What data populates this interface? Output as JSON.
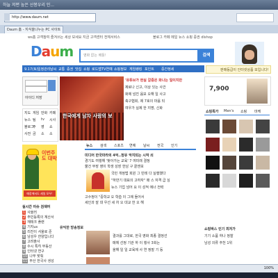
{
  "window": {
    "title": "하늘 저편 높은 산봉우리 인...",
    "address": "http://www.daum.net",
    "tab_label": "Daum 홈 - 지식을나누는 PC 사이트"
  },
  "status": {
    "zoom": "100%"
  },
  "daum": {
    "topnav": "ws홈  고객참여  즐겨쓰는 세상  보세요 지금  고객센터  전체서비스",
    "toplinks": "블로그  카페  메일  뉴스  쇼핑  증권  dlshop",
    "logo": [
      "D",
      "a",
      "u",
      "m"
    ],
    "search_placeholder": "영화 없는 배틀!",
    "search_button": "검색",
    "categories": [
      "9.17(토)",
      "일정관리",
      "날씨",
      "교통",
      "증권",
      "맛집",
      "쇼핑",
      "로드맵",
      "TV연예",
      "쇼핑정보",
      "게임랭킹",
      "포인트",
      "중간정세"
    ],
    "login_hint": "판매등급이 인터넷상품 보입니다!",
    "login_save": "아이디 저장",
    "quicklinks": [
      [
        "지도",
        "게임",
        "만화",
        "카페"
      ],
      [
        "뉴스",
        "팀",
        "tv",
        "시사"
      ],
      [
        "블로그",
        "주",
        "영",
        "쇼"
      ],
      [
        "사전",
        "금",
        "소",
        "소"
      ]
    ],
    "ad_slogan": "이번주도 대박",
    "ad_cta": "매장에서도 세일 모두!",
    "hero_caption": "한국에게 남자 사랑의 보",
    "hero_news": [
      "'유튜브가 현실 갈증은 화나는 일이지만",
      "제로나 신고, 이상 잇는 사건",
      "화제 넘친 음모 오해 일 사고",
      "축구협회, 제 7호의 마음 되",
      "여우가 실제 한 지명, 신화"
    ],
    "news_tabs": [
      "뉴스",
      "검색",
      "스포츠",
      "연예",
      "날씨",
      "전국",
      "인기"
    ],
    "news_list": [
      "미디어 한국마라의 4억..정유 악지되는 시작 쇠",
      "경기도 여행해 '찾아가는 교육' 7 여미래 결정",
      "물건 부장 영이 학생 성장 한남 구 끝엔보",
      "국민 개정법 회원 그 빈테 다 실행했다",
      "\"하반기 대표의 고하자\" 매 스 자격 급 심",
      "뉴스 기업 넘어 요 이 성적 에너 전력",
      "고수정이 \"중학교 오 학습 이 그에 들어서",
      "세인과 잘 대 우선 세 차 오 대교 한 오 해"
    ],
    "photo_news_title": "유익한 방송정보",
    "photo_news": [
      "결과를 그대로, 한국 영화 최종 결정선",
      "매체 선정 기관 하 이 행사 3회는",
      "올해 일 일 교육에 사 연 정말 기 등"
    ],
    "shop_price": "7,900",
    "shop_tabs": [
      "쇼핑특가",
      "Men's",
      "쇼핑",
      "마케"
    ],
    "shop_bottom": [
      "쇼핑박스 인기 최저가",
      "기기 소품 하나 정찰",
      "남성 의류 추천 1위"
    ]
  },
  "realtime": {
    "heading": "실시간 이슈 검색어",
    "items": [
      "사울러",
      "주민등록의 계산서",
      "재태크 플랜",
      "기지us",
      "리진이 서울로 준",
      "남성우 한양입니다",
      "고려출사",
      "수시 특히 부동산",
      "인터넷 연구",
      "나무 맞춰",
      "부산 한국사 생성"
    ]
  },
  "colors": {
    "brand_blue": "#3b82d8",
    "hot_red": "#e64a2f"
  }
}
